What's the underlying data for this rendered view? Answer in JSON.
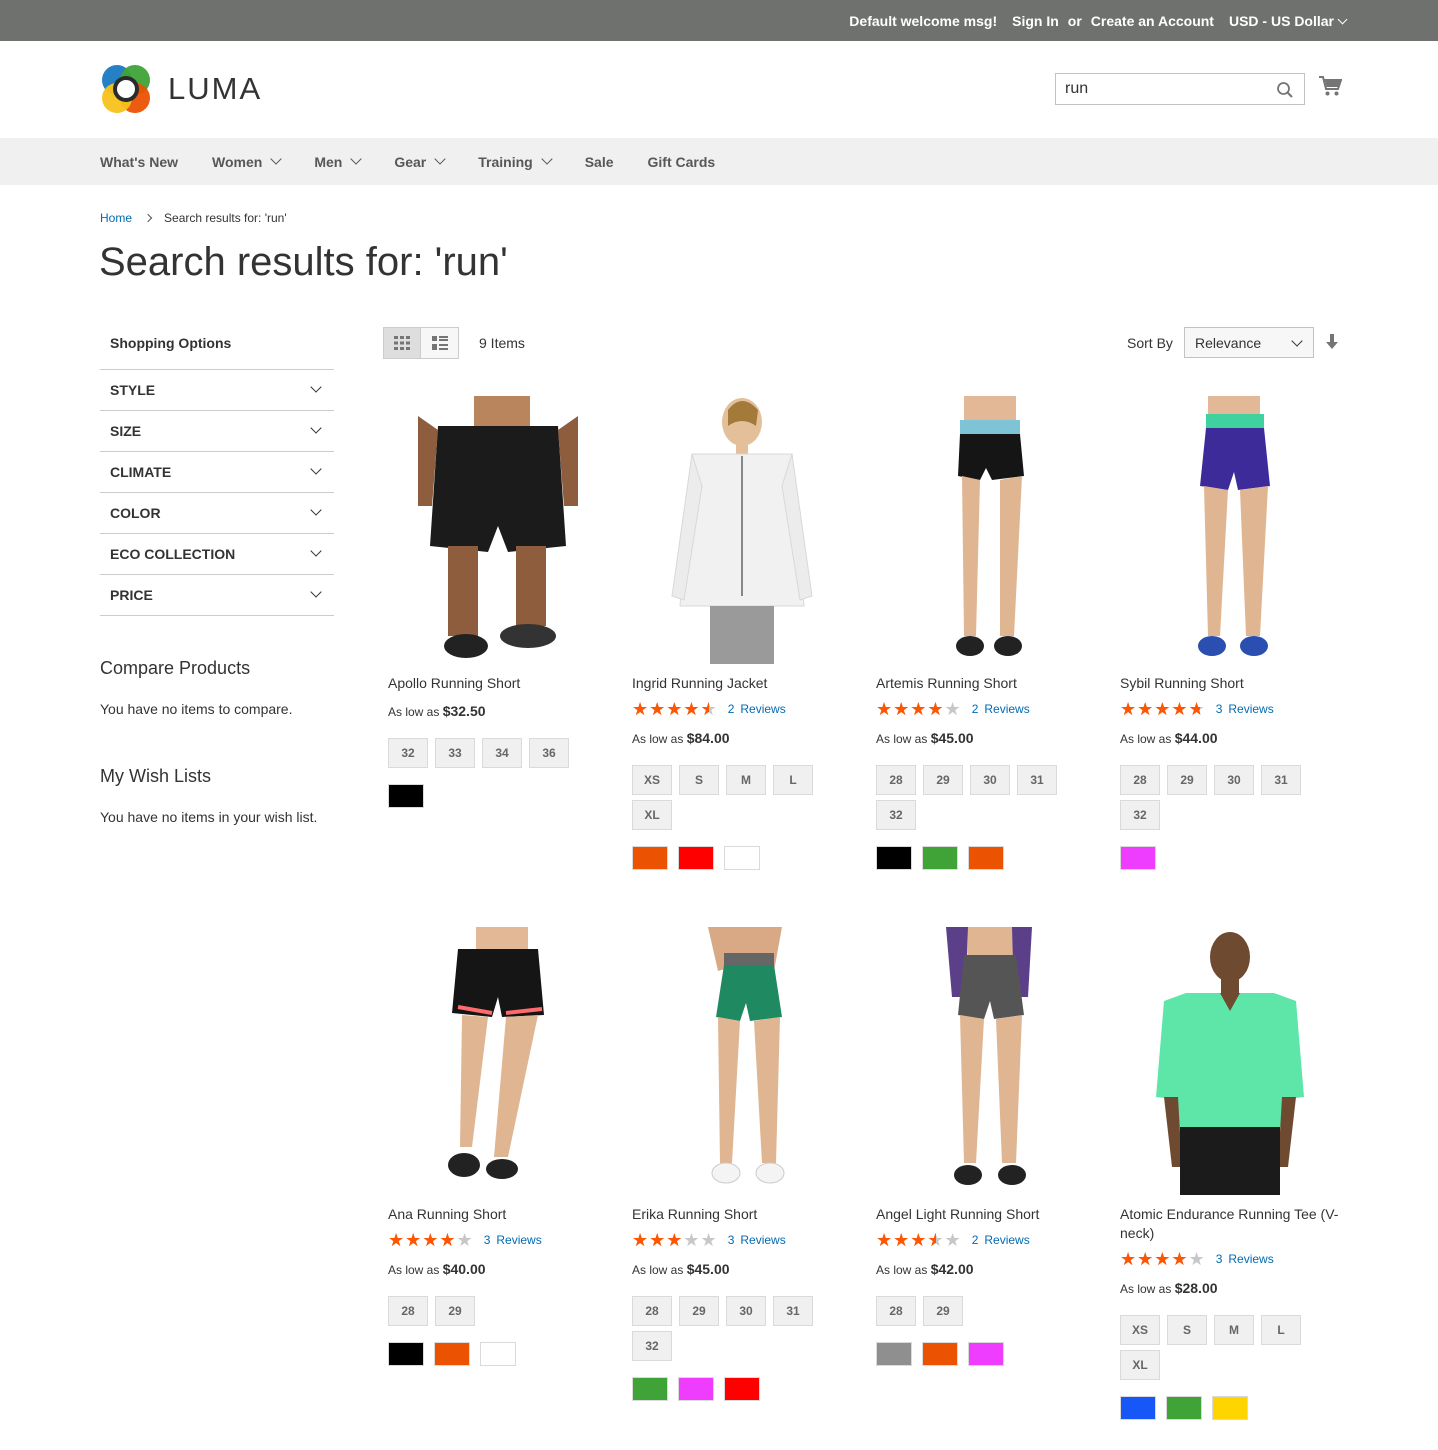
{
  "topbar": {
    "welcome": "Default welcome msg!",
    "sign_in": "Sign In",
    "or": "or",
    "create_account": "Create an Account",
    "currency": "USD - US Dollar"
  },
  "header": {
    "logo_text": "LUMA",
    "search_value": "run"
  },
  "nav": [
    "What's New",
    "Women",
    "Men",
    "Gear",
    "Training",
    "Sale",
    "Gift Cards"
  ],
  "breadcrumb": {
    "home": "Home",
    "current": "Search results for: 'run'"
  },
  "page_title": "Search results for: 'run'",
  "sidebar": {
    "shopping_options": "Shopping Options",
    "filters": [
      "STYLE",
      "SIZE",
      "CLIMATE",
      "COLOR",
      "ECO COLLECTION",
      "PRICE"
    ],
    "compare_title": "Compare Products",
    "compare_text": "You have no items to compare.",
    "wish_title": "My Wish Lists",
    "wish_text": "You have no items in your wish list."
  },
  "toolbar": {
    "items_count": "9 Items",
    "sort_label": "Sort By",
    "sort_value": "Relevance"
  },
  "price_prefix": "As low as",
  "reviews_label": "Reviews",
  "products": [
    {
      "name": "Apollo Running Short",
      "rating": null,
      "reviews": null,
      "price": "$32.50",
      "sizes": [
        "32",
        "33",
        "34",
        "36"
      ],
      "colors": [
        "#000000"
      ]
    },
    {
      "name": "Ingrid Running Jacket",
      "rating": 90,
      "reviews": "2",
      "price": "$84.00",
      "sizes": [
        "XS",
        "S",
        "M",
        "L",
        "XL"
      ],
      "colors": [
        "#eb5202",
        "#ff0000",
        "#ffffff"
      ]
    },
    {
      "name": "Artemis Running Short",
      "rating": 80,
      "reviews": "2",
      "price": "$45.00",
      "sizes": [
        "28",
        "29",
        "30",
        "31",
        "32"
      ],
      "colors": [
        "#000000",
        "#3fa338",
        "#eb5202"
      ]
    },
    {
      "name": "Sybil Running Short",
      "rating": 93,
      "reviews": "3",
      "price": "$44.00",
      "sizes": [
        "28",
        "29",
        "30",
        "31",
        "32"
      ],
      "colors": [
        "#ef3dff"
      ]
    },
    {
      "name": "Ana Running Short",
      "rating": 80,
      "reviews": "3",
      "price": "$40.00",
      "sizes": [
        "28",
        "29"
      ],
      "colors": [
        "#000000",
        "#eb5202",
        "#ffffff"
      ]
    },
    {
      "name": "Erika Running Short",
      "rating": 60,
      "reviews": "3",
      "price": "$45.00",
      "sizes": [
        "28",
        "29",
        "30",
        "31",
        "32"
      ],
      "colors": [
        "#3fa338",
        "#ef3dff",
        "#ff0000"
      ]
    },
    {
      "name": "Angel Light Running Short",
      "rating": 70,
      "reviews": "2",
      "price": "$42.00",
      "sizes": [
        "28",
        "29"
      ],
      "colors": [
        "#8f8f8f",
        "#eb5202",
        "#ef3dff"
      ]
    },
    {
      "name": "Atomic Endurance Running Tee (V-neck)",
      "rating": 80,
      "reviews": "3",
      "price": "$28.00",
      "sizes": [
        "XS",
        "S",
        "M",
        "L",
        "XL"
      ],
      "colors": [
        "#1857f7",
        "#3fa338",
        "#ffd500"
      ]
    }
  ]
}
